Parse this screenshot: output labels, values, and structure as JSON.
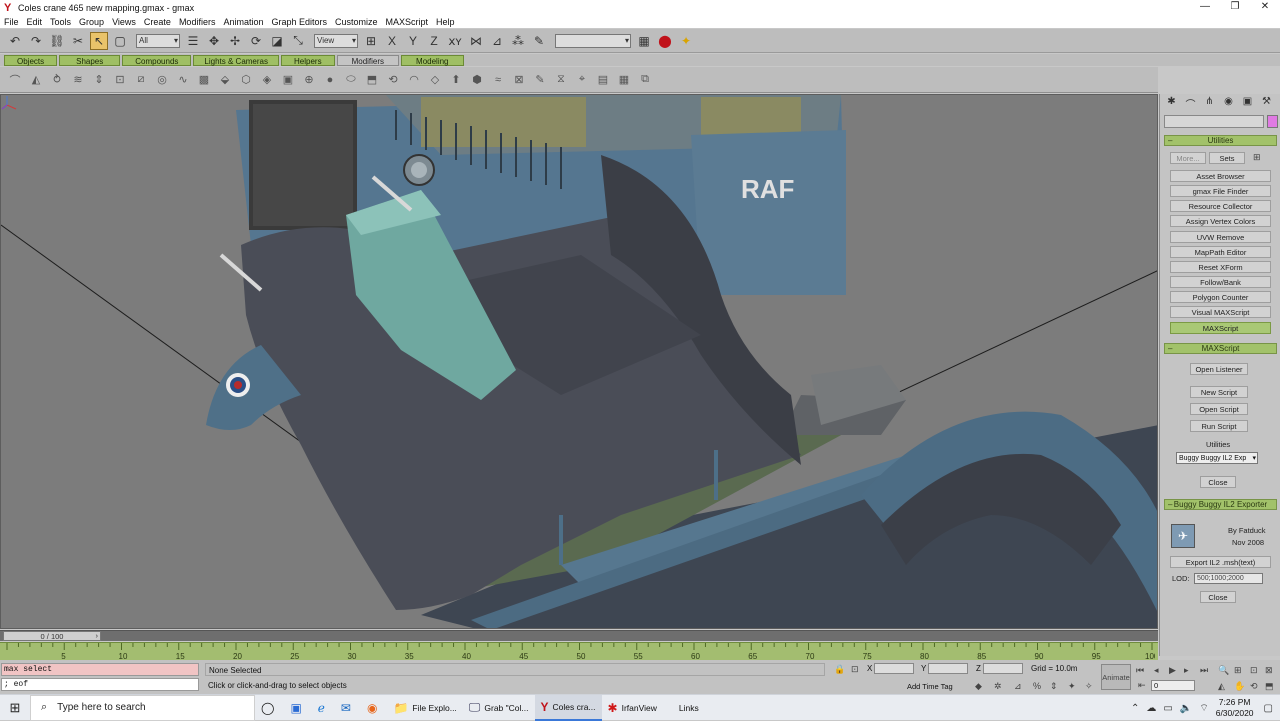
{
  "window": {
    "title": "Coles crane 465 new mapping.gmax - gmax",
    "controls": [
      "—",
      "❐",
      "✕"
    ]
  },
  "menu": [
    "File",
    "Edit",
    "Tools",
    "Group",
    "Views",
    "Create",
    "Modifiers",
    "Animation",
    "Graph Editors",
    "Customize",
    "MAXScript",
    "Help"
  ],
  "toolbar": {
    "selection_filter": "All",
    "ref_coord": "View",
    "named_sel": ""
  },
  "tabs": [
    {
      "label": "Objects",
      "active": false
    },
    {
      "label": "Shapes",
      "active": false
    },
    {
      "label": "Compounds",
      "active": false
    },
    {
      "label": "Lights & Cameras",
      "active": false
    },
    {
      "label": "Helpers",
      "active": false
    },
    {
      "label": "Modifiers",
      "active": true
    },
    {
      "label": "Modeling",
      "active": false
    }
  ],
  "viewport": {
    "decal_text": "RAF"
  },
  "panel": {
    "utilities_title": "Utilities",
    "more_label": "More...",
    "sets_label": "Sets",
    "utility_buttons": [
      "Asset Browser",
      "gmax File Finder",
      "Resource Collector",
      "Assign Vertex Colors",
      "UVW Remove",
      "MapPath Editor",
      "Reset XForm",
      "Follow/Bank",
      "Polygon Counter",
      "Visual MAXScript",
      "MAXScript"
    ],
    "active_utility": "MAXScript",
    "maxscript_title": "MAXScript",
    "open_listener": "Open Listener",
    "new_script": "New Script",
    "open_script": "Open Script",
    "run_script": "Run Script",
    "utilities_label": "Utilities",
    "utilities_select": "Buggy Buggy IL2 Exp",
    "close_label": "Close",
    "exporter_title": "Buggy Buggy IL2 Exporter",
    "exporter_by": "By Fatduck",
    "exporter_date": "Nov 2008",
    "export_button": "Export IL2 .msh(text)",
    "lod_label": "LOD:",
    "lod_value": "500;1000;2000",
    "exporter_close": "Close"
  },
  "timeline": {
    "slider_label": "0 / 100",
    "ticks": [
      5,
      10,
      15,
      20,
      25,
      30,
      35,
      40,
      45,
      50,
      55,
      60,
      65,
      70,
      75,
      80,
      85,
      90,
      95,
      100
    ]
  },
  "status": {
    "listener_top": "max select",
    "listener_bottom": "; eof",
    "selection": "None Selected",
    "prompt": "Click or click-and-drag to select objects",
    "x_label": "X",
    "y_label": "Y",
    "z_label": "Z",
    "grid": "Grid = 10.0m",
    "add_time_tag": "Add Time Tag",
    "animate": "Animate",
    "frame": "0"
  },
  "taskbar": {
    "search_placeholder": "Type here to search",
    "apps": [
      {
        "label": "File Explo...",
        "icon": "folder-icon",
        "glyph": "📁",
        "active": false
      },
      {
        "label": "Grab \"Col...",
        "icon": "grab-icon",
        "glyph": "🖵",
        "active": false
      },
      {
        "label": "Coles cra...",
        "icon": "gmax-icon",
        "glyph": "Y",
        "active": true
      },
      {
        "label": "IrfanView",
        "icon": "irfanview-icon",
        "glyph": "✱",
        "active": false
      }
    ],
    "links": "Links",
    "time": "7:26 PM",
    "date": "6/30/2020"
  },
  "colors": {
    "tab_green": "#9fbf64",
    "panel_bg": "#c4c4c4",
    "viewport_bg": "#7c7c7c",
    "model_blue": "#4f6f85",
    "model_dark": "#4a4d57",
    "model_teal": "#6fa8a0",
    "accent_pink": "#e07ae3"
  }
}
